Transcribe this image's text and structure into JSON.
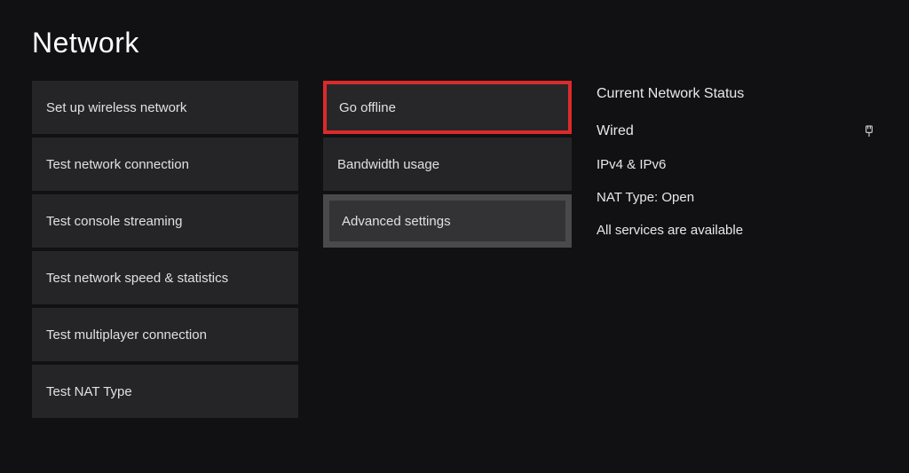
{
  "title": "Network",
  "left_column": [
    {
      "label": "Set up wireless network"
    },
    {
      "label": "Test network connection"
    },
    {
      "label": "Test console streaming"
    },
    {
      "label": "Test network speed & statistics"
    },
    {
      "label": "Test multiplayer connection"
    },
    {
      "label": "Test NAT Type"
    }
  ],
  "mid_column": [
    {
      "label": "Go offline",
      "highlight": "red"
    },
    {
      "label": "Bandwidth usage"
    },
    {
      "label": "Advanced settings",
      "highlight": "grey"
    }
  ],
  "status": {
    "heading": "Current Network Status",
    "connection_type": "Wired",
    "ip": "IPv4 & IPv6",
    "nat": "NAT Type: Open",
    "services": "All services are available"
  }
}
